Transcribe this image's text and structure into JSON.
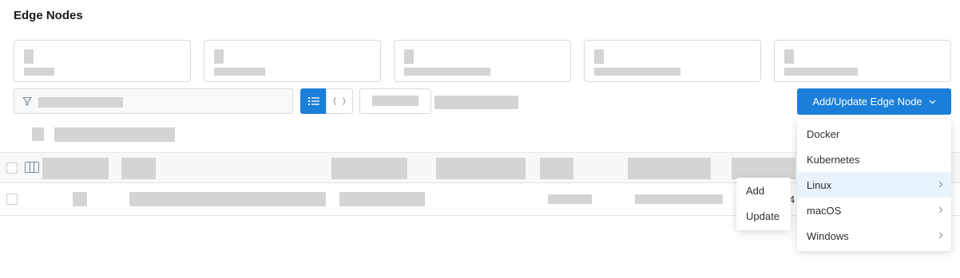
{
  "page": {
    "title": "Edge Nodes"
  },
  "toolbar": {
    "add_update_button": "Add/Update Edge Node",
    "json_view_glyph": "{ }"
  },
  "dropdown": {
    "items": [
      {
        "label": "Docker",
        "has_submenu": false
      },
      {
        "label": "Kubernetes",
        "has_submenu": false
      },
      {
        "label": "Linux",
        "has_submenu": true,
        "active": true
      },
      {
        "label": "macOS",
        "has_submenu": true
      },
      {
        "label": "Windows",
        "has_submenu": true
      }
    ]
  },
  "submenu": {
    "items": [
      {
        "label": "Add"
      },
      {
        "label": "Update"
      }
    ]
  },
  "row_fragment": "4",
  "colors": {
    "accent": "#1b7fd9",
    "placeholder": "#d4d4d4",
    "menu_active": "#e8f3fc"
  }
}
